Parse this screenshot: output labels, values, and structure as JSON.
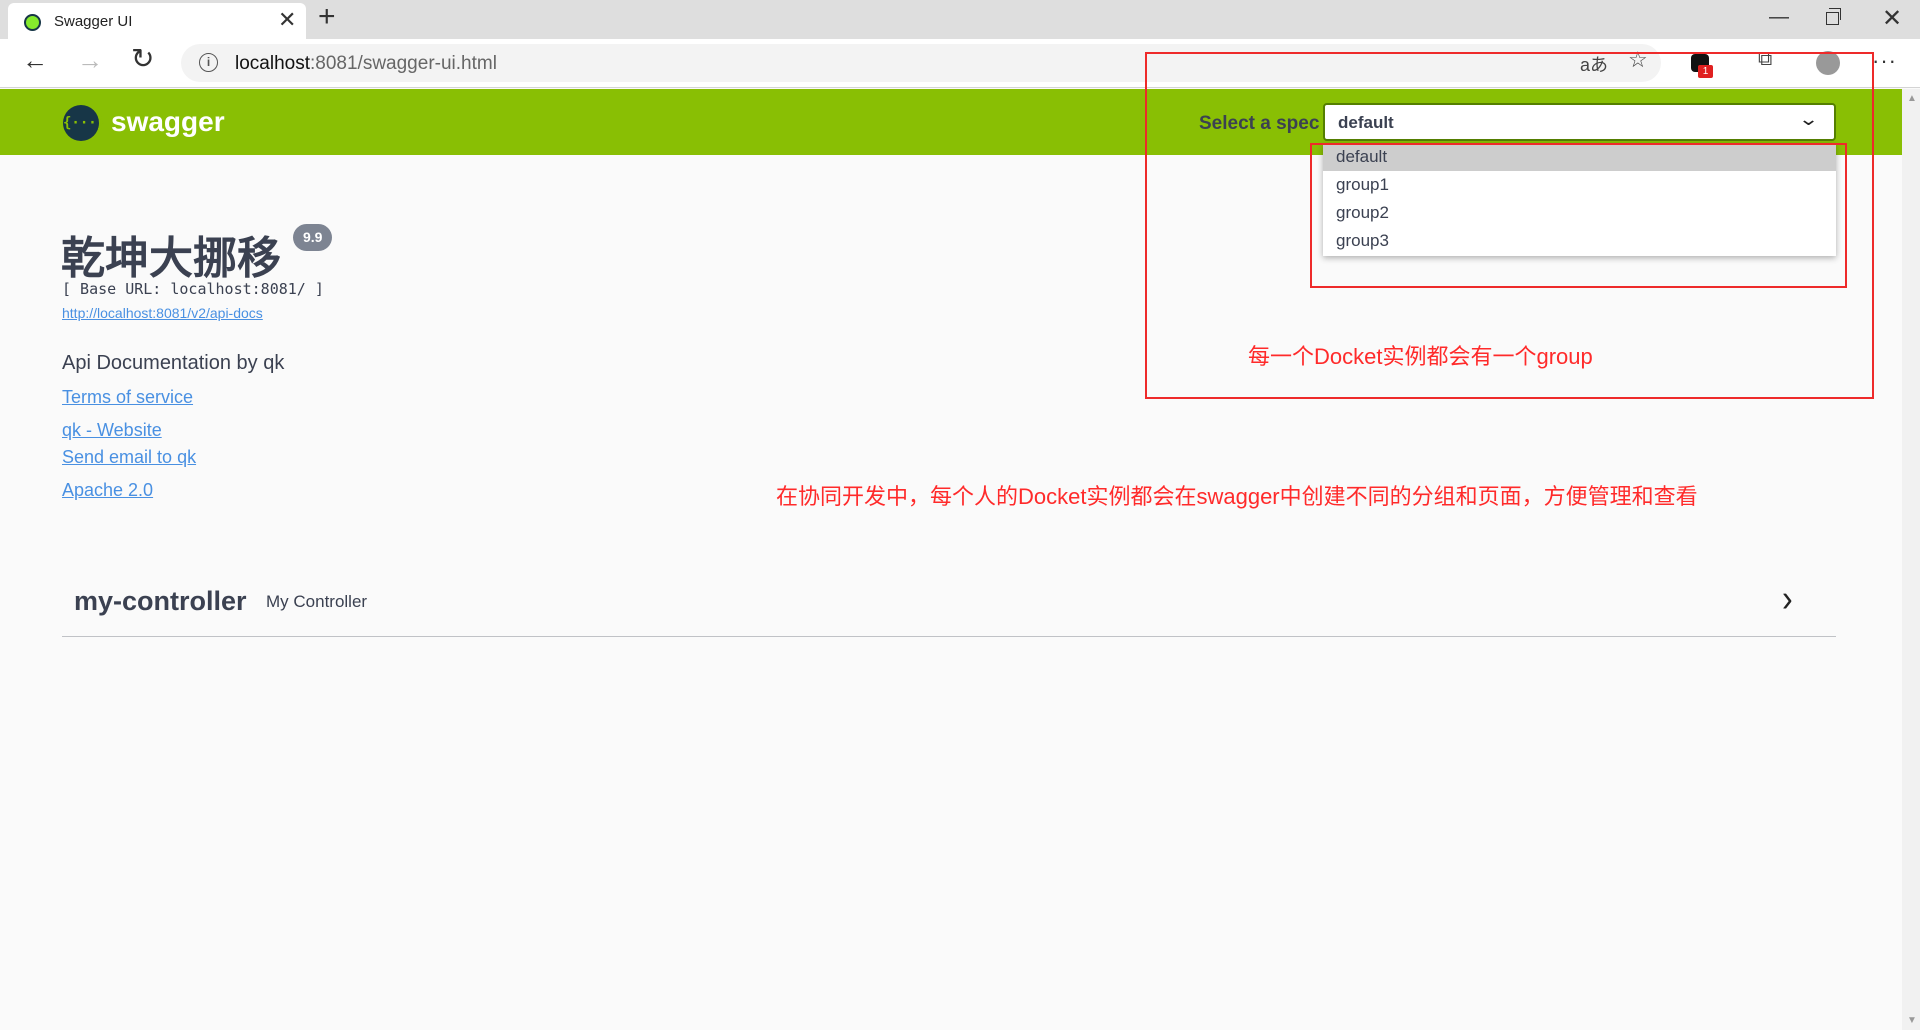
{
  "browser": {
    "tab_title": "Swagger UI",
    "url_host": "localhost",
    "url_rest": ":8081/swagger-ui.html",
    "ext_badge_count": "1"
  },
  "topbar": {
    "logo_glyph": "{···}",
    "logo_text": "swagger",
    "spec_label": "Select a spec",
    "spec_selected": "default",
    "spec_options": [
      "default",
      "group1",
      "group2",
      "group3"
    ]
  },
  "info": {
    "title": "乾坤大挪移",
    "version": "9.9",
    "base_url": "[ Base URL: localhost:8081/ ]",
    "api_docs_link": "http://localhost:8081/v2/api-docs",
    "description": "Api Documentation by qk",
    "terms": "Terms of service",
    "website": "qk - Website",
    "email": "Send email to qk",
    "license": "Apache 2.0"
  },
  "annotations": {
    "group_note": "每一个Docket实例都会有一个group",
    "collab_note": "在协同开发中，每个人的Docket实例都会在swagger中创建不同的分组和页面，方便管理和查看"
  },
  "controller": {
    "name": "my-controller",
    "description": "My Controller"
  },
  "colors": {
    "topbar": "#89bf04",
    "annotation": "#ff2a2a",
    "link": "#4990e2"
  }
}
